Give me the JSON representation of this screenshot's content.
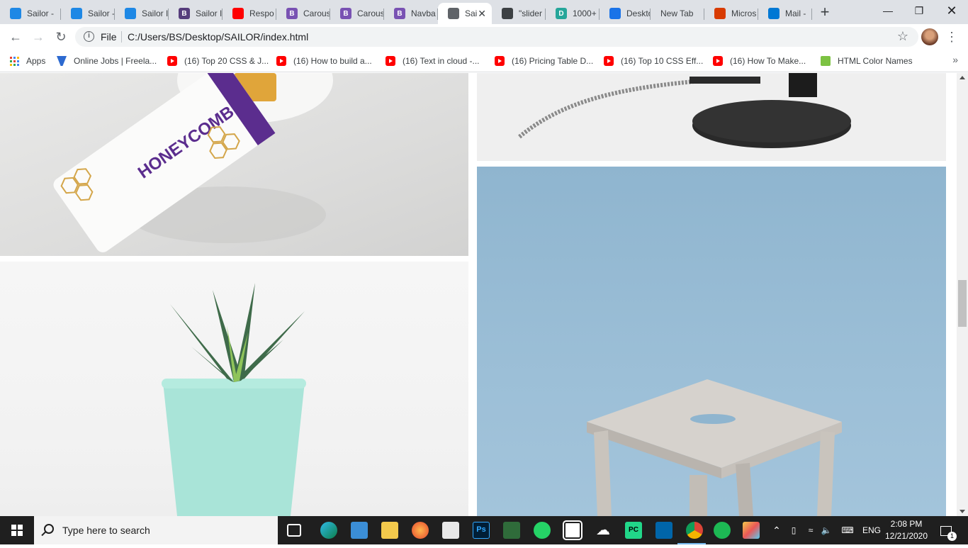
{
  "browser": {
    "tabs": [
      {
        "title": "Sailor -",
        "icon": "sailor-icon",
        "color": "#1e88e5"
      },
      {
        "title": "Sailor -",
        "icon": "sailor-icon",
        "color": "#1e88e5"
      },
      {
        "title": "Sailor I",
        "icon": "sailor-icon",
        "color": "#1e88e5"
      },
      {
        "title": "Sailor I",
        "icon": "bootstrap-icon",
        "color": "#563d7c"
      },
      {
        "title": "Respo",
        "icon": "youtube-icon",
        "color": "#ff0000"
      },
      {
        "title": "Carous",
        "icon": "bootstrap-icon",
        "color": "#7952b3"
      },
      {
        "title": "Carous",
        "icon": "bootstrap-icon",
        "color": "#7952b3"
      },
      {
        "title": "Navba",
        "icon": "bootstrap-icon",
        "color": "#7952b3"
      },
      {
        "title": "Sai",
        "icon": "globe-icon",
        "color": "#5f6368",
        "active": true
      },
      {
        "title": "\"slider",
        "icon": "eye-icon",
        "color": "#3c4043"
      },
      {
        "title": "1000+",
        "icon": "d-icon",
        "color": "#26a69a"
      },
      {
        "title": "Deskto",
        "icon": "flag-icon",
        "color": "#1a73e8"
      },
      {
        "title": "New Tab",
        "icon": "",
        "color": ""
      },
      {
        "title": "Micros",
        "icon": "office-icon",
        "color": "#d83b01"
      },
      {
        "title": "Mail -",
        "icon": "outlook-icon",
        "color": "#0078d4"
      }
    ],
    "address": {
      "scheme": "File",
      "url": "C:/Users/BS/Desktop/SAILOR/index.html"
    },
    "bookmarks": [
      {
        "label": "Apps",
        "icon": "apps-icon"
      },
      {
        "label": "Online Jobs | Freela...",
        "icon": "upwork-icon"
      },
      {
        "label": "(16) Top 20 CSS & J...",
        "icon": "youtube-icon"
      },
      {
        "label": "(16) How to build a...",
        "icon": "youtube-icon"
      },
      {
        "label": "(16) Text in cloud -...",
        "icon": "youtube-icon"
      },
      {
        "label": "(16) Pricing Table D...",
        "icon": "youtube-icon"
      },
      {
        "label": "(16) Top 10 CSS Eff...",
        "icon": "youtube-icon"
      },
      {
        "label": "(16) How To Make...",
        "icon": "youtube-icon"
      },
      {
        "label": "HTML Color Names",
        "icon": "colors-icon"
      }
    ],
    "bookmarks_more": "»"
  },
  "page": {
    "tiles": [
      {
        "name": "honeycomb-tile",
        "subject": "honeycomb-package-photo",
        "label": "HONEYCOMB"
      },
      {
        "name": "lamp-tile",
        "subject": "lamp-base-photo"
      },
      {
        "name": "succulent-tile",
        "subject": "succulent-pot-photo"
      },
      {
        "name": "stool-tile",
        "subject": "wooden-stool-photo"
      }
    ]
  },
  "taskbar": {
    "search_placeholder": "Type here to search",
    "tray": {
      "language": "ENG",
      "time": "2:08 PM",
      "date": "12/21/2020",
      "notifications": "1"
    }
  }
}
